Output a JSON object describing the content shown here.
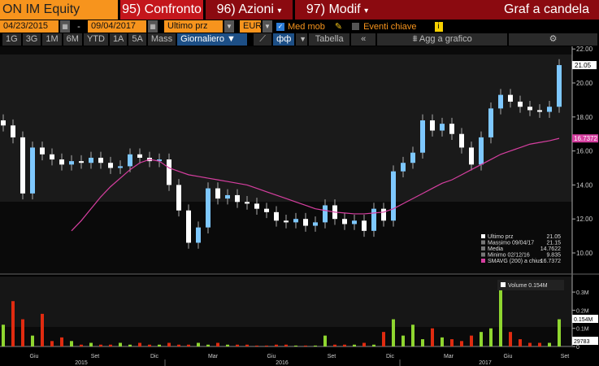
{
  "header": {
    "ticker": "ON IM Equity",
    "compare": "95) Confronto",
    "actions": "96) Azioni",
    "modify": "97) Modif",
    "title": "Graf a candela"
  },
  "controls": {
    "start_date": "04/23/2015",
    "dash": "-",
    "end_date": "09/04/2017",
    "field": "Ultimo prz",
    "currency": "EUR",
    "moving_avg": "Med mob",
    "key_events": "Eventi chiave",
    "info": "i"
  },
  "toolbar": {
    "periods": [
      "1G",
      "3G",
      "1M",
      "6M",
      "YTD",
      "1A",
      "5A",
      "Mass"
    ],
    "frequency": "Giornaliero ▼",
    "table": "Tabella",
    "collapse": "«",
    "add_to_chart": "Agg a grafico"
  },
  "colors": {
    "up": "#7ec8ff",
    "down": "#ffffff",
    "sma": "#d63fa0",
    "vol_up": "#8fd630",
    "vol_down": "#e02b10",
    "orange": "#f7941d"
  },
  "legend": {
    "rows": [
      {
        "label": "Ultimo prz",
        "value": "21.05"
      },
      {
        "label": "Massimo 09/04/17",
        "value": "21.15"
      },
      {
        "label": "Media",
        "value": "14.7622"
      },
      {
        "label": "Minimo 02/12/16",
        "value": "9.835"
      },
      {
        "label": "SMAVG (200) a chius",
        "value": "16.7372"
      }
    ],
    "volume": "Volume 0.154M"
  },
  "tags": {
    "last": "21.05",
    "sma": "16.7372",
    "vol": "0.154M",
    "vol_avg": "29783"
  },
  "chart_data": {
    "type": "candlestick",
    "title": "Graf a candela",
    "ylim": [
      9,
      22.5
    ],
    "yticks": [
      "10.00",
      "12.00",
      "14.00",
      "16.00",
      "18.00",
      "20.00",
      "22.00"
    ],
    "xticks": [
      "Giu",
      "Set",
      "Dic",
      "Mar",
      "Giu",
      "Set",
      "Dic",
      "Mar",
      "Giu",
      "Set"
    ],
    "years": [
      "2015",
      "2016",
      "2017"
    ],
    "close": [
      17.5,
      16.8,
      13.5,
      16.2,
      15.8,
      15.5,
      15.2,
      15.4,
      15.3,
      15.6,
      15.3,
      15.0,
      15.1,
      15.8,
      15.6,
      15.4,
      15.5,
      14.0,
      12.5,
      10.6,
      11.5,
      13.8,
      13.2,
      13.4,
      13.0,
      12.9,
      12.6,
      12.4,
      11.9,
      11.8,
      12.0,
      11.6,
      11.8,
      12.8,
      12.0,
      11.7,
      11.9,
      11.3,
      12.6,
      11.9,
      14.8,
      15.3,
      15.9,
      17.8,
      17.2,
      17.6,
      17.0,
      16.2,
      15.2,
      16.8,
      18.5,
      19.3,
      18.9,
      18.6,
      18.4,
      18.3,
      18.6,
      21.05
    ],
    "sma200": [
      null,
      null,
      null,
      null,
      null,
      null,
      null,
      11.3,
      11.9,
      12.6,
      13.3,
      13.9,
      14.4,
      14.9,
      15.3,
      15.5,
      15.4,
      15.0,
      14.8,
      14.6,
      14.5,
      14.4,
      14.3,
      14.2,
      14.1,
      14.0,
      13.8,
      13.6,
      13.4,
      13.2,
      13.0,
      12.8,
      12.6,
      12.5,
      12.4,
      12.35,
      12.3,
      12.3,
      12.35,
      12.4,
      12.6,
      12.9,
      13.2,
      13.5,
      13.8,
      14.1,
      14.3,
      14.6,
      14.9,
      15.2,
      15.5,
      15.8,
      16.0,
      16.2,
      16.4,
      16.5,
      16.6,
      16.74
    ],
    "volume_M": [
      0.12,
      0.25,
      0.15,
      0.06,
      0.18,
      0.03,
      0.05,
      0.03,
      0.01,
      0.02,
      0.01,
      0.01,
      0.02,
      0.01,
      0.02,
      0.01,
      0.01,
      0.02,
      0.01,
      0.01,
      0.02,
      0.01,
      0.02,
      0.01,
      0.01,
      0.01,
      0.005,
      0.005,
      0.01,
      0.01,
      0.005,
      0.005,
      0.005,
      0.06,
      0.01,
      0.01,
      0.01,
      0.02,
      0.01,
      0.08,
      0.15,
      0.06,
      0.12,
      0.04,
      0.1,
      0.05,
      0.04,
      0.03,
      0.06,
      0.08,
      0.1,
      0.35,
      0.08,
      0.04,
      0.02,
      0.02,
      0.02,
      0.15
    ],
    "vol_ticks": [
      "0",
      "0.1M",
      "0.2M",
      "0.3M"
    ],
    "vol_ylim": [
      0,
      0.38
    ]
  }
}
